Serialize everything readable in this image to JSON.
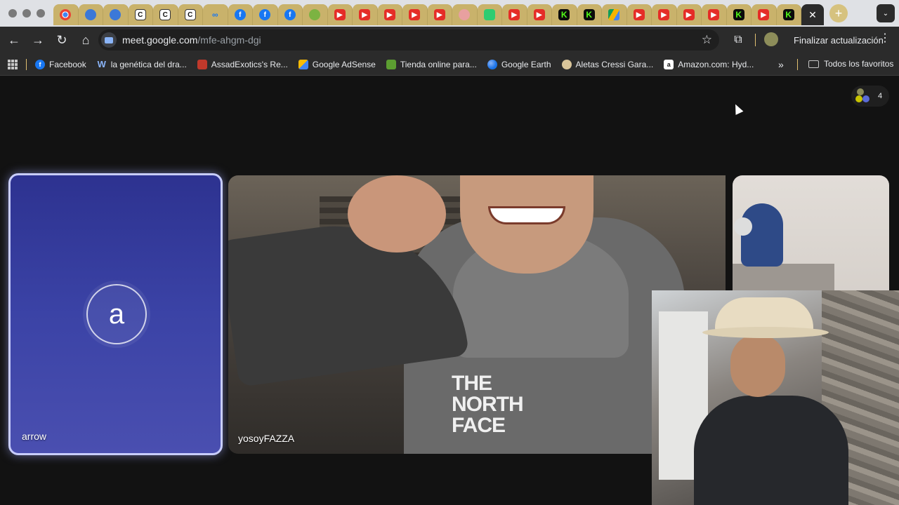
{
  "window": {
    "traffic_lights": [
      "close",
      "minimize",
      "zoom"
    ]
  },
  "tabs": [
    {
      "icon": "chrome-icon"
    },
    {
      "icon": "cloud-icon"
    },
    {
      "icon": "cloud-icon"
    },
    {
      "icon": "c-icon",
      "glyph": "C"
    },
    {
      "icon": "c-icon",
      "glyph": "C"
    },
    {
      "icon": "c-icon",
      "glyph": "C"
    },
    {
      "icon": "meta-icon",
      "glyph": "∞"
    },
    {
      "icon": "facebook-icon",
      "glyph": "f"
    },
    {
      "icon": "facebook-icon",
      "glyph": "f"
    },
    {
      "icon": "facebook-icon",
      "glyph": "f"
    },
    {
      "icon": "green-icon"
    },
    {
      "icon": "youtube-icon",
      "glyph": "▶"
    },
    {
      "icon": "youtube-icon",
      "glyph": "▶"
    },
    {
      "icon": "youtube-icon",
      "glyph": "▶"
    },
    {
      "icon": "youtube-icon",
      "glyph": "▶"
    },
    {
      "icon": "youtube-icon",
      "glyph": "▶"
    },
    {
      "icon": "pink-icon"
    },
    {
      "icon": "telegram-icon"
    },
    {
      "icon": "youtube-icon",
      "glyph": "▶"
    },
    {
      "icon": "youtube-icon",
      "glyph": "▶"
    },
    {
      "icon": "kick-icon",
      "glyph": "K"
    },
    {
      "icon": "kick-icon",
      "glyph": "K"
    },
    {
      "icon": "drive-icon"
    },
    {
      "icon": "youtube-icon",
      "glyph": "▶"
    },
    {
      "icon": "youtube-icon",
      "glyph": "▶"
    },
    {
      "icon": "youtube-icon",
      "glyph": "▶"
    },
    {
      "icon": "youtube-icon",
      "glyph": "▶"
    },
    {
      "icon": "kick-icon",
      "glyph": "K"
    },
    {
      "icon": "youtube-icon",
      "glyph": "▶"
    },
    {
      "icon": "kick-icon",
      "glyph": "K"
    }
  ],
  "active_tab": {
    "close_glyph": "✕"
  },
  "new_tab_glyph": "+",
  "tab_search_glyph": "⌄",
  "toolbar": {
    "back": "←",
    "forward": "→",
    "reload": "↻",
    "home": "⌂",
    "url_host": "meet.google.com",
    "url_path": "/mfe-ahgm-dgi",
    "bookmark_star": "☆",
    "extensions_icon": "⧉",
    "update_label": "Finalizar actualización",
    "menu": "⋮"
  },
  "bookmarks": [
    {
      "label": "Facebook",
      "icon": "facebook-icon",
      "glyph": "f",
      "cls": "fb"
    },
    {
      "label": "la genética del dra...",
      "icon": "w-icon",
      "glyph": "W",
      "cls": "w"
    },
    {
      "label": "AssadExotics's Re...",
      "icon": "assad-icon",
      "glyph": "",
      "cls": "ae"
    },
    {
      "label": "Google AdSense",
      "icon": "adsense-icon",
      "glyph": "",
      "cls": "ads"
    },
    {
      "label": "Tienda online para...",
      "icon": "tienda-icon",
      "glyph": "",
      "cls": "tienda"
    },
    {
      "label": "Google Earth",
      "icon": "earth-icon",
      "glyph": "",
      "cls": "earth"
    },
    {
      "label": "Aletas Cressi Gara...",
      "icon": "cressi-icon",
      "glyph": "",
      "cls": "cressi"
    },
    {
      "label": "Amazon.com: Hyd...",
      "icon": "amazon-icon",
      "glyph": "a",
      "cls": "amz"
    }
  ],
  "bookmarks_more": "»",
  "all_bookmarks_label": "Todos los favoritos",
  "meet": {
    "participant_count": "4",
    "tiles": {
      "arrow": {
        "initial": "a",
        "name": "arrow"
      },
      "main": {
        "name": "yosoyFAZZA",
        "shirt_text": "THE\nNORTH\nFACE"
      }
    }
  }
}
